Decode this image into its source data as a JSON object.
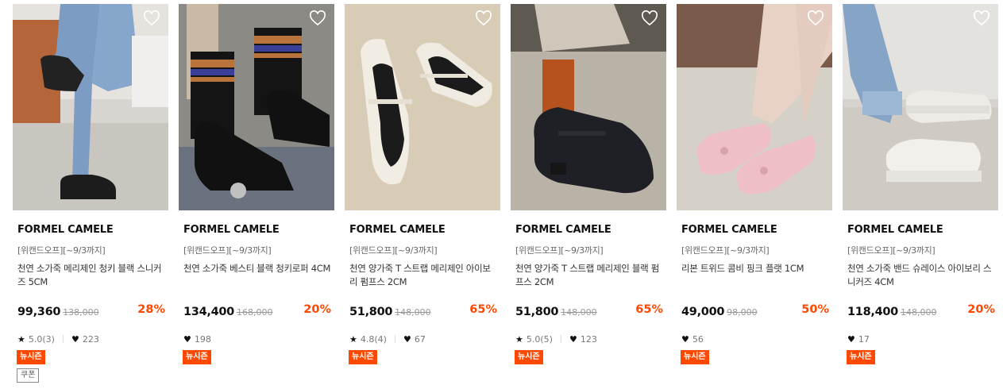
{
  "colors": {
    "accent": "#ff4800",
    "text": "#111111",
    "muted": "#999999"
  },
  "products": [
    {
      "brand": "FORMEL CAMELE",
      "promo": "[위캔드오프][~9/3까지]",
      "name": "천연 소가죽 메리제인 청키 블랙 스니커즈 5CM",
      "price": "99,360",
      "original_price": "138,000",
      "discount": "28%",
      "rating": "5.0(3)",
      "likes": "223",
      "badge_new": "뉴시즌",
      "badge_coupon": "쿠폰",
      "wish_icon": "heart-outline-icon"
    },
    {
      "brand": "FORMEL CAMELE",
      "promo": "[위캔드오프][~9/3까지]",
      "name": "천연 소가죽 베스티 블랙 청키로퍼 4CM",
      "price": "134,400",
      "original_price": "168,000",
      "discount": "20%",
      "rating": null,
      "likes": "198",
      "badge_new": "뉴시즌",
      "wish_icon": "heart-outline-icon"
    },
    {
      "brand": "FORMEL CAMELE",
      "promo": "[위캔드오프][~9/3까지]",
      "name": "천연 양가죽 T 스트랩 메리제인 아이보리 펌프스 2CM",
      "price": "51,800",
      "original_price": "148,000",
      "discount": "65%",
      "rating": "4.8(4)",
      "likes": "67",
      "badge_new": "뉴시즌",
      "wish_icon": "heart-outline-icon"
    },
    {
      "brand": "FORMEL CAMELE",
      "promo": "[위캔드오프][~9/3까지]",
      "name": "천연 양가죽 T 스트랩 메리제인 블랙 펌프스 2CM",
      "price": "51,800",
      "original_price": "148,000",
      "discount": "65%",
      "rating": "5.0(5)",
      "likes": "123",
      "badge_new": "뉴시즌",
      "wish_icon": "heart-outline-icon"
    },
    {
      "brand": "FORMEL CAMELE",
      "promo": "[위캔드오프][~9/3까지]",
      "name": "리본 트위드 콤비 핑크 플랫 1CM",
      "price": "49,000",
      "original_price": "98,000",
      "discount": "50%",
      "rating": null,
      "likes": "56",
      "badge_new": "뉴시즌",
      "wish_icon": "heart-outline-icon"
    },
    {
      "brand": "FORMEL CAMELE",
      "promo": "[위캔드오프][~9/3까지]",
      "name": "천연 소가죽 밴드 슈레이스 아이보리 스니커즈 4CM",
      "price": "118,400",
      "original_price": "148,000",
      "discount": "20%",
      "rating": null,
      "likes": "17",
      "badge_new": "뉴시즌",
      "wish_icon": "heart-outline-icon"
    }
  ]
}
